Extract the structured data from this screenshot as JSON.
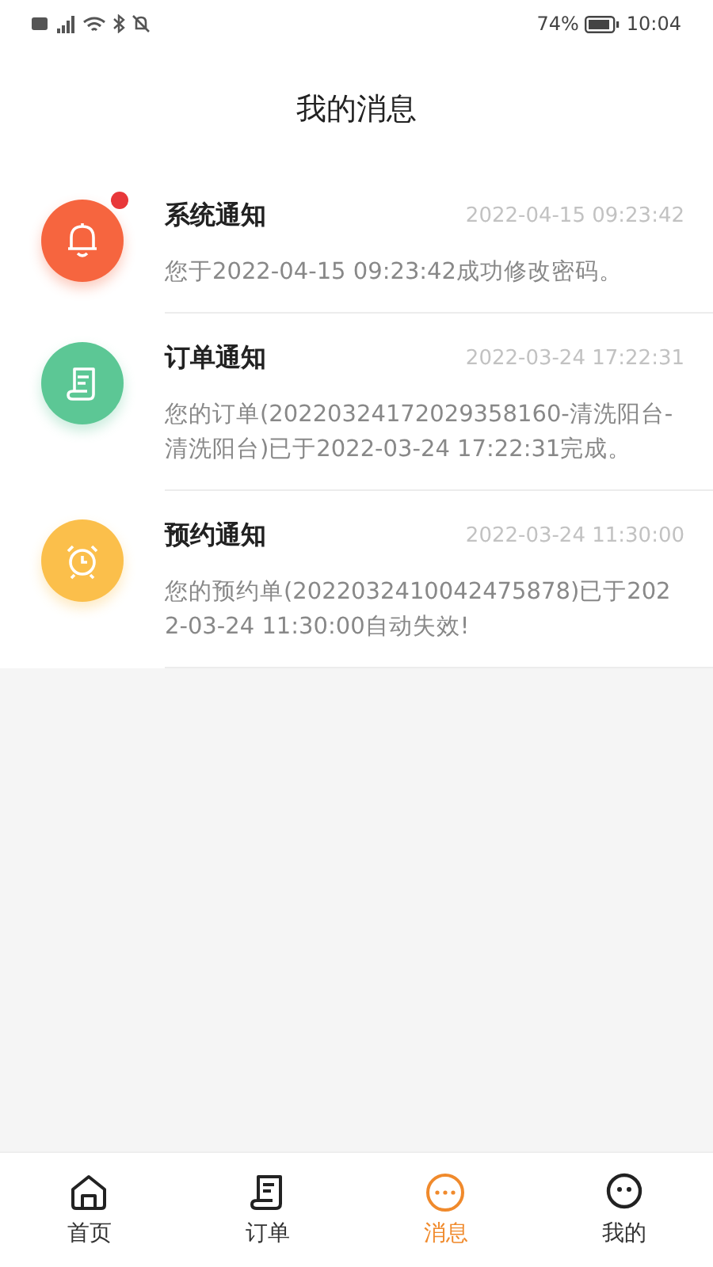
{
  "status_bar": {
    "battery_text": "74%",
    "time": "10:04"
  },
  "header": {
    "title": "我的消息"
  },
  "messages": [
    {
      "kind": "bell",
      "color": "#f6653f",
      "unread": true,
      "title": "系统通知",
      "time": "2022-04-15 09:23:42",
      "body": "您于2022-04-15 09:23:42成功修改密码。"
    },
    {
      "kind": "order",
      "color": "#5cc795",
      "unread": false,
      "title": "订单通知",
      "time": "2022-03-24 17:22:31",
      "body": "您的订单(20220324172029358160-清洗阳台-清洗阳台)已于2022-03-24 17:22:31完成。"
    },
    {
      "kind": "clock",
      "color": "#fbbf4b",
      "unread": false,
      "title": "预约通知",
      "time": "2022-03-24 11:30:00",
      "body": "您的预约单(2022032410042475878)已于2022-03-24 11:30:00自动失效!"
    }
  ],
  "tabs": [
    {
      "kind": "home",
      "label": "首页",
      "selected": false
    },
    {
      "kind": "order",
      "label": "订单",
      "selected": false
    },
    {
      "kind": "message",
      "label": "消息",
      "selected": true
    },
    {
      "kind": "me",
      "label": "我的",
      "selected": false
    }
  ]
}
